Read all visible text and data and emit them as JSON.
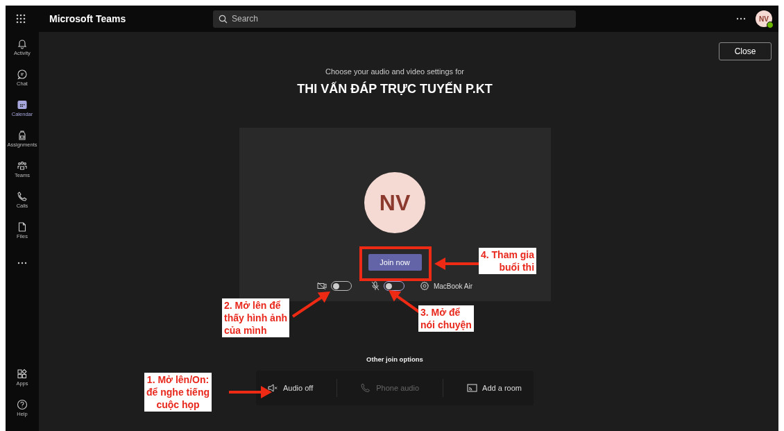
{
  "app_bar": {
    "app_name": "Microsoft Teams",
    "search": {
      "placeholder": "Search"
    },
    "avatar": {
      "initials": "NV"
    }
  },
  "sidebar": {
    "items": [
      {
        "label": "Activity",
        "kind": "bell",
        "selected": false
      },
      {
        "label": "Chat",
        "kind": "chat",
        "selected": false
      },
      {
        "label": "Calendar",
        "kind": "calendar",
        "selected": true
      },
      {
        "label": "Assignments",
        "kind": "backpack",
        "selected": false
      },
      {
        "label": "Teams",
        "kind": "people",
        "selected": false
      },
      {
        "label": "Calls",
        "kind": "phone",
        "selected": false
      },
      {
        "label": "Files",
        "kind": "file",
        "selected": false
      }
    ],
    "bottom_items": [
      {
        "label": "Apps",
        "kind": "apps",
        "selected": false
      },
      {
        "label": "Help",
        "kind": "help",
        "selected": false
      }
    ]
  },
  "close_button": "Close",
  "prejoin": {
    "subtitle": "Choose your audio and video settings for",
    "meeting_title": "THI VẤN ĐÁP TRỰC TUYẾN P.KT",
    "avatar_initials": "NV",
    "join_button": "Join now",
    "camera": {
      "on": false
    },
    "microphone": {
      "on": false
    },
    "device": "MacBook Air"
  },
  "other_options": {
    "heading": "Other join options",
    "options": [
      {
        "label": "Audio off",
        "kind": "speaker",
        "disabled": false
      },
      {
        "label": "Phone audio",
        "kind": "phone",
        "disabled": true
      },
      {
        "label": "Add a room",
        "kind": "cast",
        "disabled": false
      }
    ]
  },
  "annotations": [
    {
      "text": "1. Mở lên/On:\nđể nghe tiếng\ncuộc họp"
    },
    {
      "text": "2. Mở lên để\nthấy hình ảnh\ncủa mình"
    },
    {
      "text": "3. Mở để\nnói chuyện"
    },
    {
      "text": "4. Tham gia\nbuổi thi"
    }
  ]
}
